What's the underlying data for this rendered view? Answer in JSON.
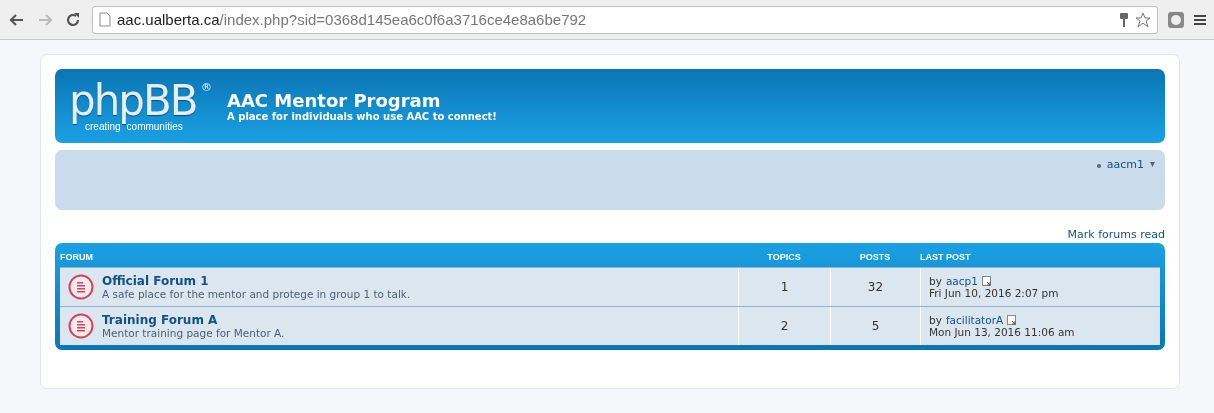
{
  "browser": {
    "url_host": "aac.ualberta.ca",
    "url_path": "/index.php?sid=0368d145ea6c0f6a3716ce4e8a6be792"
  },
  "logo": {
    "wordmark": "phpBB",
    "registered": "®",
    "tagline": [
      "creating",
      "communities"
    ]
  },
  "site": {
    "title": "AAC Mentor Program",
    "description": "A place for individuals who use AAC to connect!"
  },
  "navbar": {
    "user": "aacm1",
    "caret": "▾"
  },
  "mark_forums_read": "Mark forums read",
  "table": {
    "columns": [
      "FORUM",
      "TOPICS",
      "POSTS",
      "LAST POST"
    ],
    "rows": [
      {
        "name": "Official Forum 1",
        "description": "A safe place for the mentor and protege in group 1 to talk.",
        "topics": "1",
        "posts": "32",
        "by": "by",
        "author": "aacp1",
        "date": "Fri Jun 10, 2016 2:07 pm"
      },
      {
        "name": "Training Forum A",
        "description": "Mentor training page for Mentor A.",
        "topics": "2",
        "posts": "5",
        "by": "by",
        "author": "facilitatorA",
        "date": "Mon Jun 13, 2016 11:06 am"
      }
    ]
  }
}
